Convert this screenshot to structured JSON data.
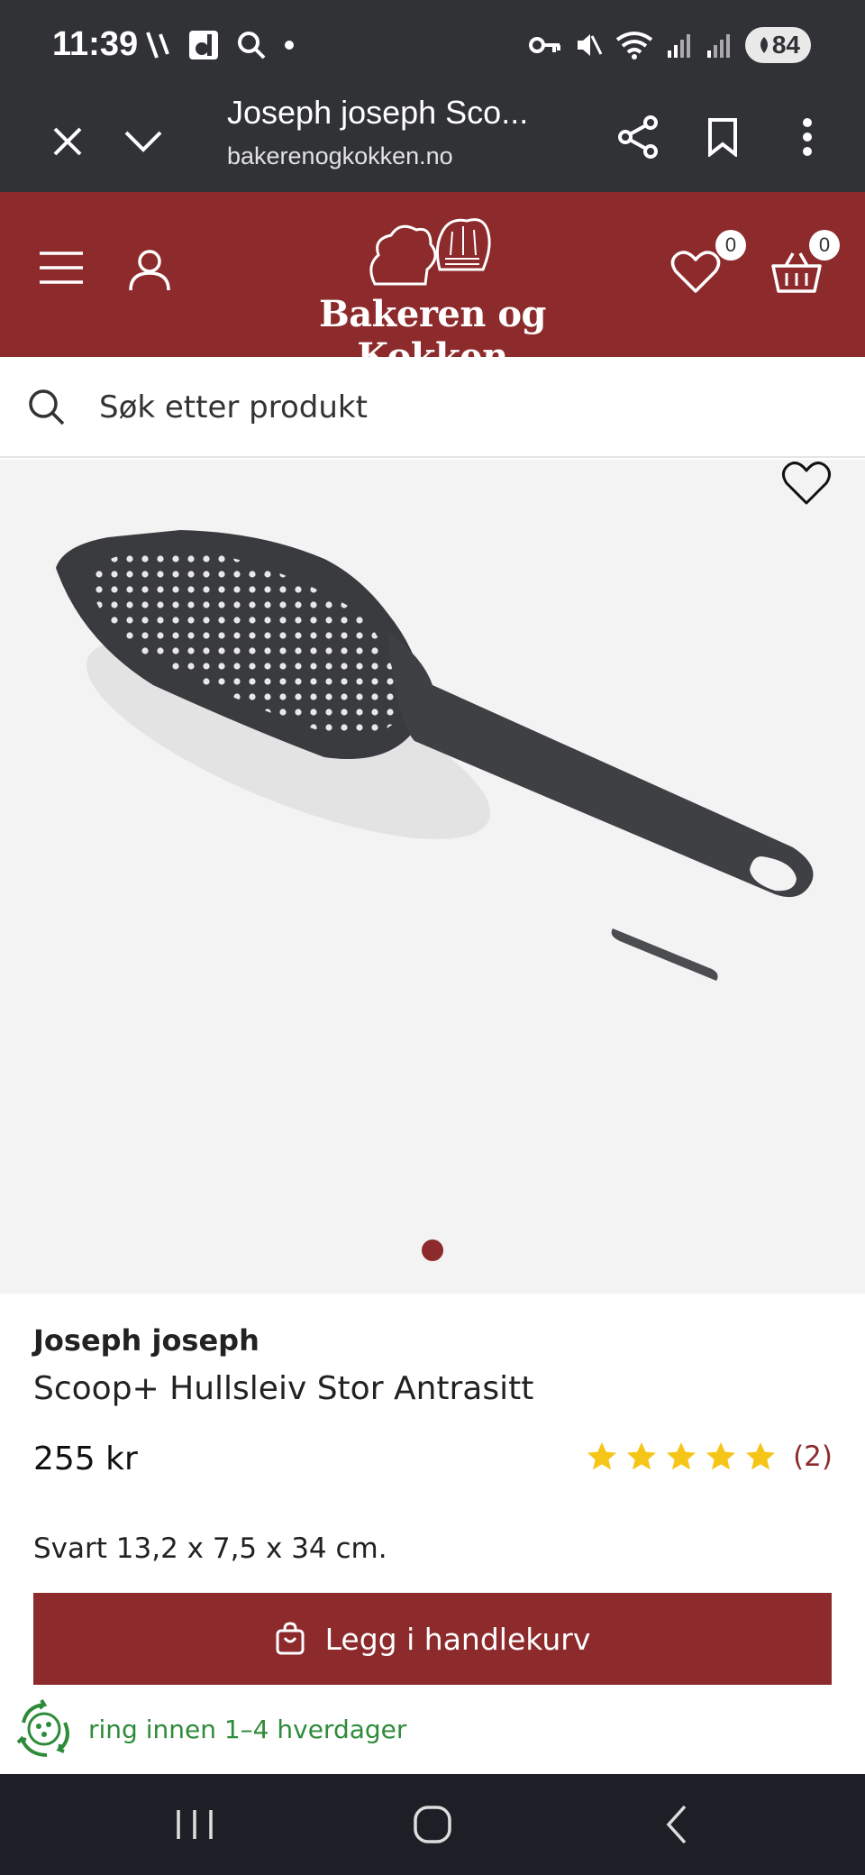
{
  "status_bar": {
    "time": "11:39",
    "battery": "84"
  },
  "tab_bar": {
    "title": "Joseph joseph Sco...",
    "url": "bakerenogkokken.no"
  },
  "header": {
    "logo_text": "Bakeren og Kokken",
    "wishlist_count": "0",
    "cart_count": "0",
    "brand_color": "#8d2a2c"
  },
  "search": {
    "placeholder": "Søk etter produkt"
  },
  "product": {
    "brand": "Joseph joseph",
    "name": "Scoop+ Hullsleiv Stor Antrasitt",
    "price": "255 kr",
    "rating_stars": 5,
    "rating_count": "(2)",
    "description": "Svart 13,2 x 7,5 x 34 cm.",
    "image_count": 1,
    "active_image": 1,
    "handle_label": "joseph joseph"
  },
  "actions": {
    "add_to_cart_label": "Legg i handlekurv"
  },
  "delivery": {
    "text": "ring innen 1–4 hverdager",
    "color": "#2e8b3a"
  },
  "icons": {
    "star_color": "#f5c518"
  }
}
